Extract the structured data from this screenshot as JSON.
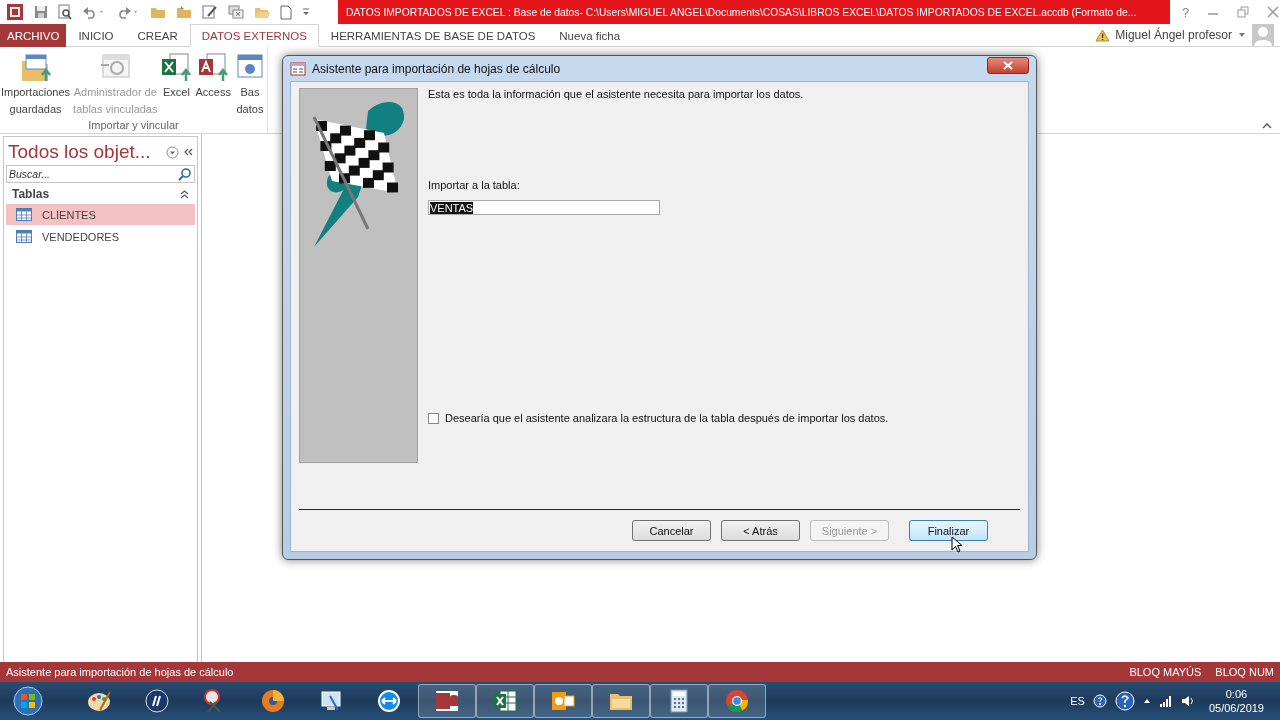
{
  "window": {
    "title": "DATOS IMPORTADOS DE EXCEL : Base de datos- C:\\Users\\MIGUEL ANGEL\\Documents\\COSAS\\LIBROS EXCEL\\DATOS IMPORTADOS DE EXCEL.accdb (Formato de...",
    "help": "?"
  },
  "ribbon_tabs": [
    {
      "label": "ARCHIVO",
      "kind": "file",
      "selected": false
    },
    {
      "label": "INICIO",
      "kind": "tab",
      "selected": false
    },
    {
      "label": "CREAR",
      "kind": "tab",
      "selected": false
    },
    {
      "label": "DATOS EXTERNOS",
      "kind": "tab",
      "selected": true
    },
    {
      "label": "HERRAMIENTAS DE BASE DE DATOS",
      "kind": "tab",
      "selected": false
    },
    {
      "label": "Nueva ficha",
      "kind": "tab",
      "selected": false
    }
  ],
  "account": {
    "name": "Miguel Ángel profesor"
  },
  "ribbon": {
    "group_label": "Importar y vincular",
    "buttons": [
      {
        "lines": [
          "Importaciones",
          "guardadas"
        ],
        "disabled": false
      },
      {
        "lines": [
          "Administrador de",
          "tablas vinculadas"
        ],
        "disabled": true
      },
      {
        "lines": [
          "Excel"
        ],
        "disabled": false
      },
      {
        "lines": [
          "Access"
        ],
        "disabled": false
      },
      {
        "lines": [
          "Bas",
          "datos"
        ],
        "disabled": false
      }
    ]
  },
  "nav": {
    "title": "Todos los objet...",
    "search": {
      "placeholder": "Buscar..."
    },
    "groups": [
      {
        "label": "Tablas",
        "items": [
          {
            "label": "CLIENTES",
            "selected": true
          },
          {
            "label": "VENDEDORES",
            "selected": false
          }
        ]
      }
    ]
  },
  "dialog": {
    "title": "Asistente para importación de hojas de cálculo",
    "intro": "Esta es toda la información que el asistente necesita para importar los datos.",
    "table_label": "Importar a la tabla:",
    "table_name": "VENTAS",
    "analyze": {
      "label": "Desearía que el asistente analizara la estructura de la tabla después de importar los datos.",
      "checked": false
    },
    "buttons": [
      {
        "label": "Cancelar",
        "kind": "normal",
        "disabled": false
      },
      {
        "label": "< Atrás",
        "kind": "normal",
        "disabled": false
      },
      {
        "label": "Siguiente >",
        "kind": "normal",
        "disabled": true
      },
      {
        "label": "Finalizar",
        "kind": "default",
        "disabled": false
      }
    ]
  },
  "status_bar": {
    "text": "Asistente para importación de hojas de cálculo",
    "indicators": [
      "BLOQ MAYÚS",
      "BLOQ NUM"
    ]
  },
  "taskbar": {
    "apps": [
      {
        "open": false
      },
      {
        "open": false
      },
      {
        "open": false
      },
      {
        "open": false
      },
      {
        "open": false
      },
      {
        "open": false
      },
      {
        "open": true
      },
      {
        "open": true
      },
      {
        "open": true
      },
      {
        "open": true
      },
      {
        "open": true
      },
      {
        "open": true
      }
    ],
    "language": "ES",
    "time": "0:06",
    "date": "05/06/2019"
  }
}
